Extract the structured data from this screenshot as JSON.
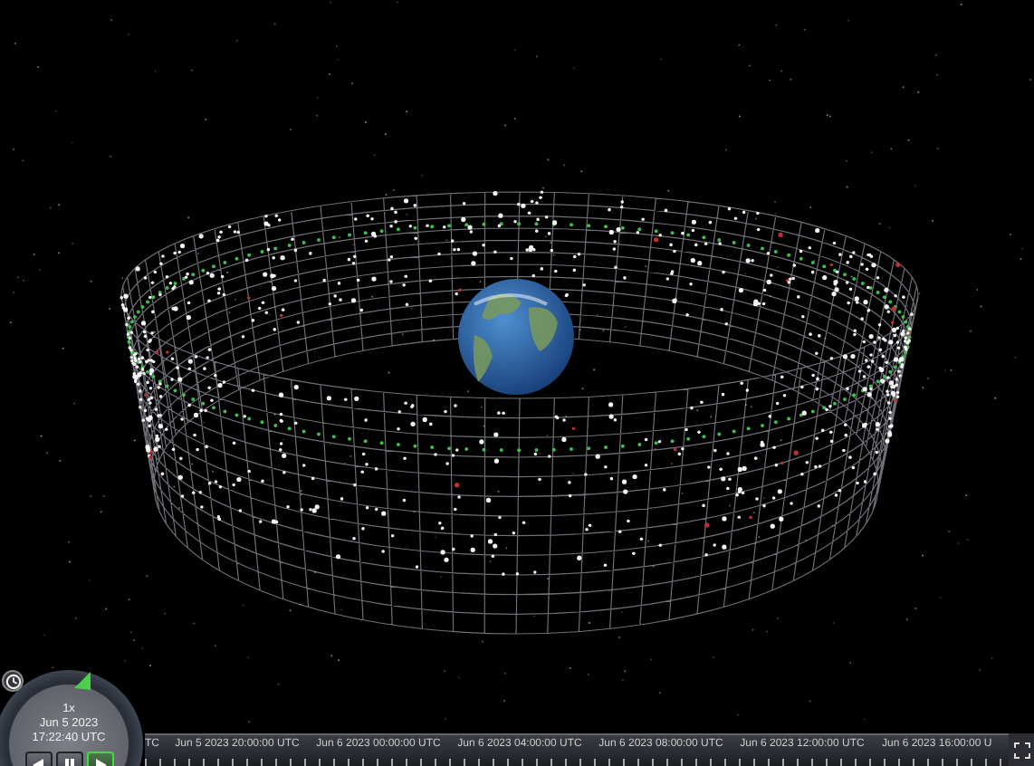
{
  "animation": {
    "speed": "1x",
    "date": "Jun 5 2023",
    "time": "17:22:40 UTC",
    "playing": true
  },
  "timeline": {
    "labels": [
      "TC",
      "Jun 5 2023 20:00:00 UTC",
      "Jun 6 2023 00:00:00 UTC",
      "Jun 6 2023 04:00:00 UTC",
      "Jun 6 2023 08:00:00 UTC",
      "Jun 6 2023 12:00:00 UTC",
      "Jun 6 2023 16:00:00 U"
    ]
  }
}
